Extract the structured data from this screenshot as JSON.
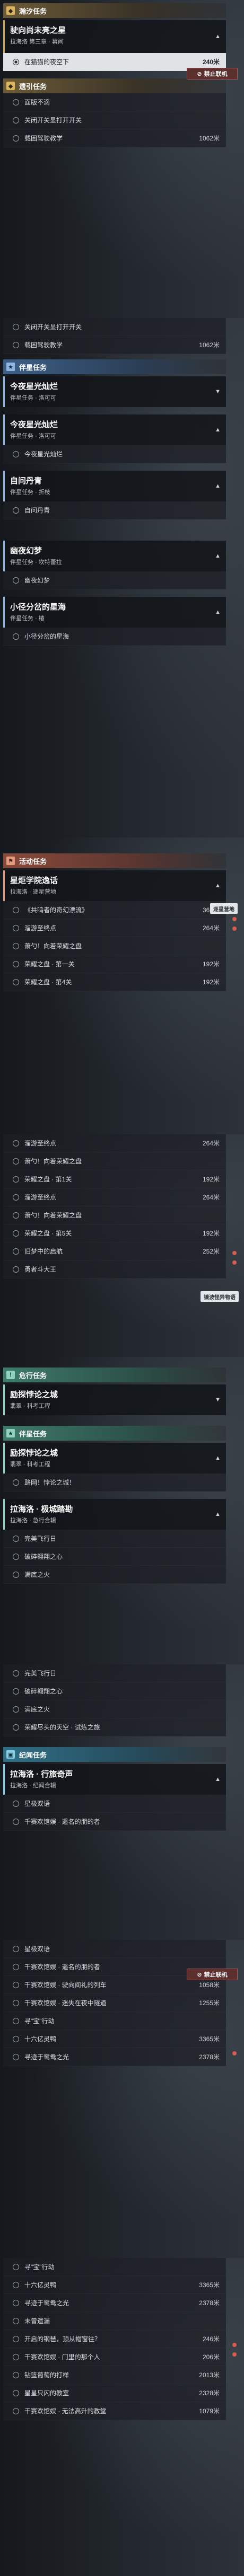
{
  "seg1": {
    "header_top": "瀚汐任务",
    "card": {
      "title": "驶向尚未亮之星",
      "subtitle": "拉海洛 第三章 · 幕间"
    },
    "active_row": {
      "label": "在猫猫的夜空下",
      "distance": "240米"
    },
    "ban_badge": "禁止联机",
    "header_daily": "遗引任务",
    "rows": [
      {
        "label": "面版不滴"
      },
      {
        "label": "关闭开关显打开开关"
      },
      {
        "label": "载困驾驶教学",
        "distance": "1062米"
      }
    ]
  },
  "seg2": {
    "row_top": {
      "label": "关闭开关显打开开关"
    },
    "row_2": {
      "label": "载困驾驶教学",
      "distance": "1062米"
    },
    "header": "伴星任务",
    "card1": {
      "title": "今夜星光灿烂",
      "subtitle": "伴星任务 · 洛可可"
    },
    "card2": {
      "title": "今夜星光灿烂",
      "subtitle": "伴星任务 · 洛可可"
    },
    "row_a": {
      "label": "今夜星光灿烂"
    },
    "card3": {
      "title": "自问丹青",
      "subtitle": "伴星任务 · 折枝"
    },
    "row_b": {
      "label": "自问丹青"
    },
    "card4": {
      "title": "幽夜幻梦",
      "subtitle": "伴星任务 · 坎特蕾拉"
    },
    "row_c": {
      "label": "幽夜幻梦"
    },
    "card5": {
      "title": "小径分岔的星海",
      "subtitle": "伴星任务 · 椿"
    },
    "row_d": {
      "label": "小径分岔的星海"
    }
  },
  "seg3": {
    "header": "活动任务",
    "card": {
      "title": "星炬学院逸话",
      "subtitle": "拉海洛 · 逐星营地"
    },
    "badge": "逐星营地",
    "rows": [
      {
        "label": "《共鸣者的奇幻漂流》",
        "distance": "362米"
      },
      {
        "label": "溜游至终点",
        "distance": "264米"
      },
      {
        "label": "萧勺！向着荣耀之盘"
      },
      {
        "label": "荣耀之盘 · 第一关",
        "distance": "192米"
      },
      {
        "label": "荣耀之盘 · 第4关",
        "distance": "192米"
      }
    ]
  },
  "seg4": {
    "rows": [
      {
        "label": "溜游至终点",
        "distance": "264米"
      },
      {
        "label": "萧勺！向着荣耀之盘"
      },
      {
        "label": "荣耀之盘 · 第1关",
        "distance": "192米"
      },
      {
        "label": "溜游至终点",
        "distance": "264米"
      },
      {
        "label": "萧勺！向着荣耀之盘"
      },
      {
        "label": "荣耀之盘 · 第5关",
        "distance": "192米"
      },
      {
        "label": "旧梦中的启航",
        "distance": "252米"
      },
      {
        "label": "勇者斗大王",
        "distance": ""
      }
    ],
    "badge": "镜波怪异物语"
  },
  "seg5": {
    "header": "危行任务",
    "card1": {
      "title": "励探悖论之城",
      "subtitle": "翡翠 · 科考工程"
    },
    "header2": "伴星任务",
    "card2": {
      "title": "励探悖论之城",
      "subtitle": "翡翠 · 科考工程"
    },
    "row_a": {
      "label": "路网！悖论之城！"
    },
    "card3": {
      "title": "拉海洛 · 极城踏勘",
      "subtitle": "拉海洛 · 急行合辑"
    },
    "rows": [
      {
        "label": "完美飞行日"
      },
      {
        "label": "破碎翱翔之心"
      },
      {
        "label": "满底之火"
      }
    ]
  },
  "seg6": {
    "rows": [
      {
        "label": "完美飞行日"
      },
      {
        "label": "破碎翱翔之心"
      },
      {
        "label": "满底之火"
      },
      {
        "label": "荣耀尽头的天空 · 试炼之旅"
      }
    ],
    "header": "纪闻任务",
    "card": {
      "title": "拉海洛 · 行旅奇声",
      "subtitle": "拉海洛 · 纪闻合辑"
    },
    "rows2": [
      {
        "label": "星极双语"
      },
      {
        "label": "千赛欢馆娱 · 遥名的朋的者"
      }
    ]
  },
  "seg7": {
    "rows": [
      {
        "label": "星极双语"
      },
      {
        "label": "千赛欢馆娱 · 遥名的朋的者"
      },
      {
        "label": "千赛欢馆娱 · 驶向间礼的列车",
        "distance": "1058米"
      },
      {
        "label": "千赛欢馆娱 · 迷失在夜中隧道",
        "distance": "1255米"
      },
      {
        "label": "寻\"宝\"行动",
        "distance": ""
      },
      {
        "label": "十六亿灵鸭",
        "distance": "3365米"
      },
      {
        "label": "寻迹于鸳鸯之光",
        "distance": "2378米"
      }
    ],
    "ban_badge": "禁止联机"
  },
  "seg8": {
    "rows": [
      {
        "label": "寻\"宝\"行动",
        "distance": ""
      },
      {
        "label": "十六亿灵鸭",
        "distance": "3365米"
      },
      {
        "label": "寻迹于鸳鸯之光",
        "distance": "2378米"
      },
      {
        "label": "未曾遗漏",
        "distance": ""
      },
      {
        "label": "开启的钢琶，顶从帽窗往？",
        "distance": "246米"
      },
      {
        "label": "千赛欢馆娱 · 门里的那个人",
        "distance": "206米"
      },
      {
        "label": "钻篮葡萄的打样",
        "distance": "2013米"
      },
      {
        "label": "星星只闪的教室",
        "distance": "2328米"
      },
      {
        "label": "千赛欢馆娱 · 无法高升的教堂",
        "distance": "1079米"
      }
    ]
  }
}
